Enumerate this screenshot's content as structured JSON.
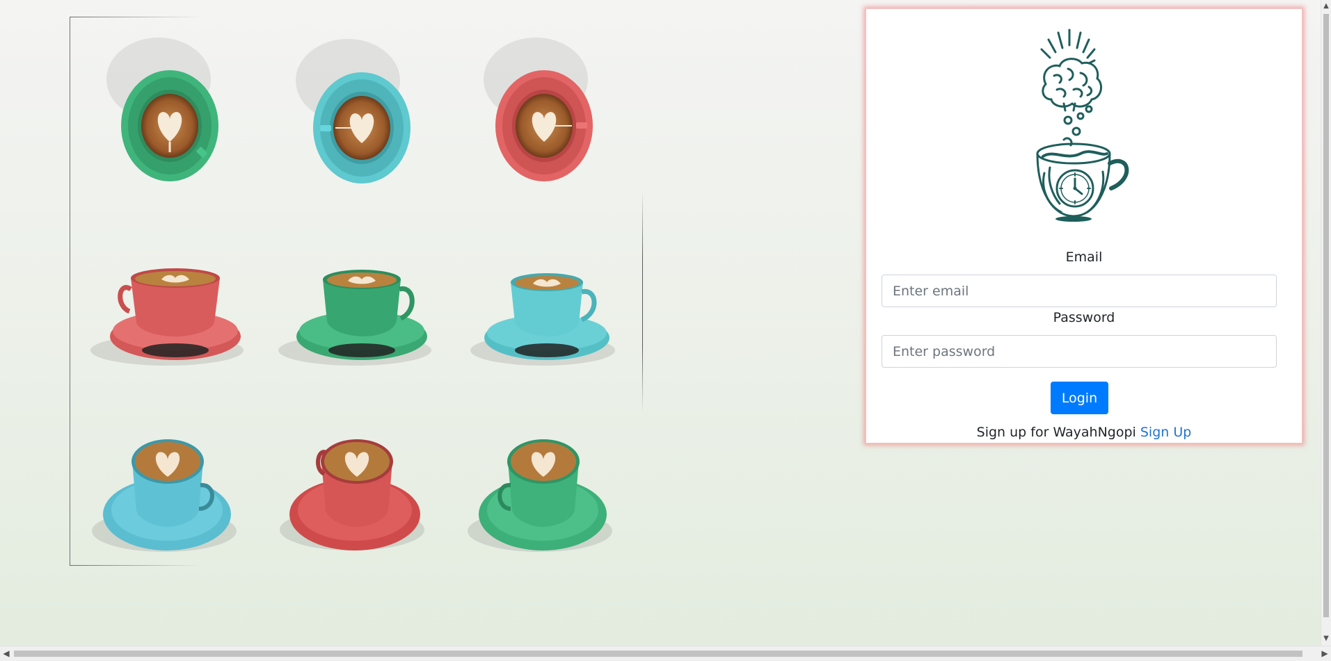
{
  "brand": "WayahNgopi",
  "colors": {
    "accent": "#007bff",
    "link": "#1f74d4",
    "logo": "#1e5e5b",
    "card_glow": "#f07878",
    "cup_green": "#3fb57c",
    "cup_teal": "#5ec9cf",
    "cup_red": "#e26464"
  },
  "collage": {
    "label": "coffee cups collage",
    "cups": [
      {
        "name": "cup-top-green",
        "color": "green",
        "view": "top"
      },
      {
        "name": "cup-top-teal",
        "color": "teal",
        "view": "top"
      },
      {
        "name": "cup-top-red",
        "color": "red",
        "view": "top"
      },
      {
        "name": "cup-side-red",
        "color": "red",
        "view": "side"
      },
      {
        "name": "cup-side-green",
        "color": "green",
        "view": "side"
      },
      {
        "name": "cup-side-teal",
        "color": "teal",
        "view": "side"
      },
      {
        "name": "cup-angle-teal",
        "color": "teal",
        "view": "angle"
      },
      {
        "name": "cup-angle-red",
        "color": "red",
        "view": "angle"
      },
      {
        "name": "cup-angle-green",
        "color": "green",
        "view": "angle"
      }
    ]
  },
  "login": {
    "logo_icon": "brain-coffee-clock-icon",
    "email_label": "Email",
    "email_placeholder": "Enter email",
    "email_value": "",
    "password_label": "Password",
    "password_placeholder": "Enter password",
    "password_value": "",
    "login_button": "Login",
    "signup_text": "Sign up for WayahNgopi",
    "signup_link": "Sign Up"
  },
  "scrollbars": {
    "vertical_up_icon": "chevron-up-icon",
    "vertical_down_icon": "chevron-down-icon",
    "horizontal_left_icon": "chevron-left-icon",
    "horizontal_right_icon": "chevron-right-icon"
  }
}
